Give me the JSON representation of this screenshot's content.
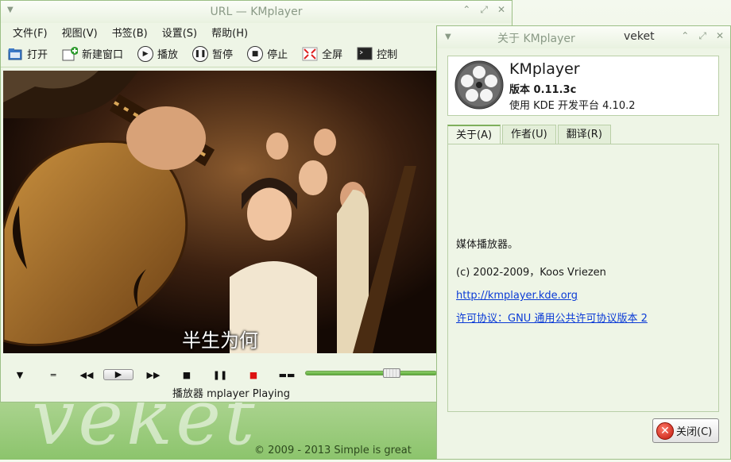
{
  "desktop": {
    "logo_text": "veket",
    "footer": "© 2009 - 2013 Simple is great"
  },
  "player": {
    "title": "URL  —  KMplayer",
    "menu": [
      "文件(F)",
      "视图(V)",
      "书签(B)",
      "设置(S)",
      "帮助(H)"
    ],
    "toolbar": {
      "open": "打开",
      "new_window": "新建窗口",
      "play": "播放",
      "pause": "暂停",
      "stop": "停止",
      "fullscreen": "全屏",
      "console": "控制"
    },
    "subtitle": "半生为何",
    "status": "播放器 mplayer Playing",
    "seek_position": 0.68
  },
  "about": {
    "title": "关于 KMplayer",
    "host": "veket",
    "app_name": "KMplayer",
    "version": "版本 0.11.3c",
    "platform": "使用 KDE 开发平台 4.10.2",
    "tabs": [
      "关于(A)",
      "作者(U)",
      "翻译(R)"
    ],
    "description": "媒体播放器。",
    "copyright": "(c) 2002-2009，Koos Vriezen",
    "homepage": "http://kmplayer.kde.org",
    "license": "许可协议：GNU 通用公共许可协议版本 2",
    "close_label": "关闭(C)"
  },
  "colors": {
    "link": "#0b3bd6",
    "slider": "#6ec048"
  }
}
